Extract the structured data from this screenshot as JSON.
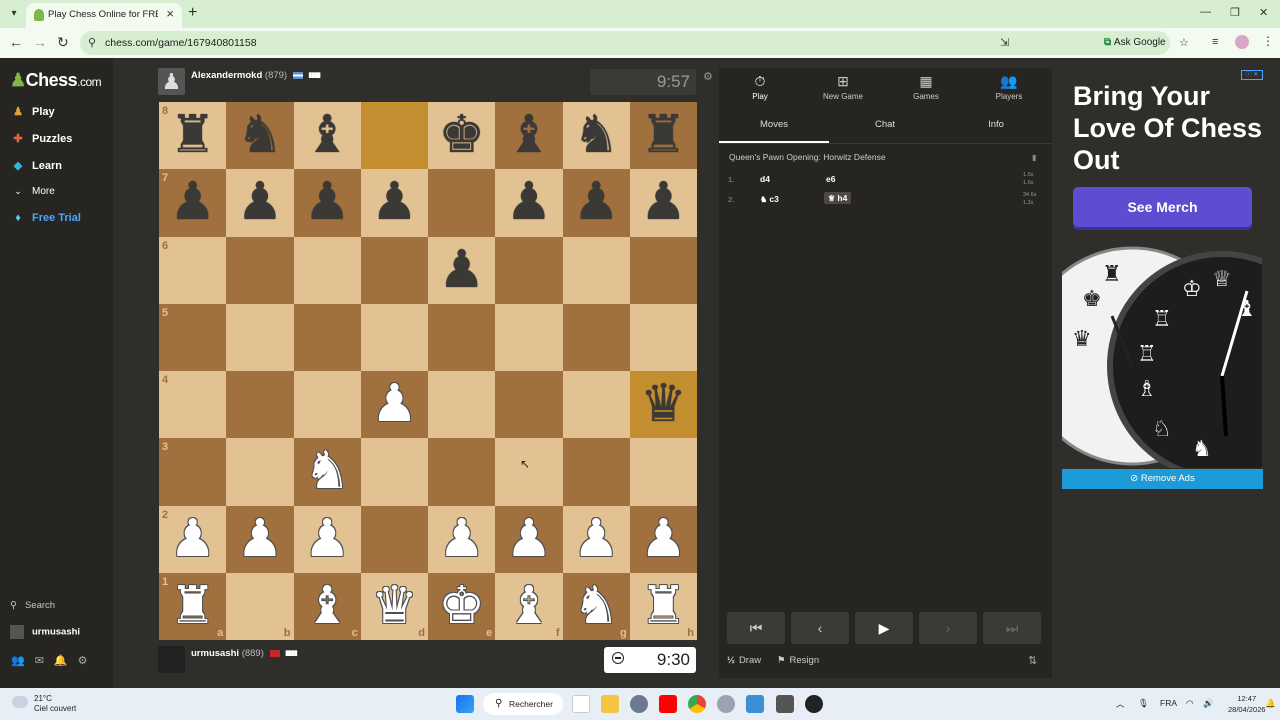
{
  "browser": {
    "tab_title": "Play Chess Online for FREE - 2 P",
    "url": "chess.com/game/167940801158",
    "ask_google": "Ask Google"
  },
  "sidebar": {
    "logo_main": "Chess",
    "logo_suffix": ".com",
    "items": [
      {
        "label": "Play",
        "icon": "play-pawn-icon"
      },
      {
        "label": "Puzzles",
        "icon": "puzzle-icon"
      },
      {
        "label": "Learn",
        "icon": "learn-cap-icon"
      },
      {
        "label": "More",
        "icon": "chevron-down-icon"
      },
      {
        "label": "Free Trial",
        "icon": "diamond-icon"
      }
    ],
    "search": "Search",
    "username": "urmusashi"
  },
  "top_player": {
    "name": "Alexandermokd",
    "rating": "(879)",
    "clock": "9:57"
  },
  "bottom_player": {
    "name": "urmusashi",
    "rating": "(889)",
    "clock": "9:30"
  },
  "board": {
    "ranks": [
      "8",
      "7",
      "6",
      "5",
      "4",
      "3",
      "2",
      "1"
    ],
    "files": [
      "a",
      "b",
      "c",
      "d",
      "e",
      "f",
      "g",
      "h"
    ],
    "highlight": [
      "d8",
      "h4"
    ],
    "pieces": {
      "a8": "bR",
      "b8": "bN",
      "c8": "bB",
      "e8": "bK",
      "f8": "bB",
      "g8": "bN",
      "h8": "bR",
      "a7": "bP",
      "b7": "bP",
      "c7": "bP",
      "d7": "bP",
      "f7": "bP",
      "g7": "bP",
      "h7": "bP",
      "e6": "bP",
      "h4": "bQ",
      "d4": "wP",
      "c3": "wN",
      "a2": "wP",
      "b2": "wP",
      "c2": "wP",
      "e2": "wP",
      "f2": "wP",
      "g2": "wP",
      "h2": "wP",
      "a1": "wR",
      "c1": "wB",
      "d1": "wQ",
      "e1": "wK",
      "f1": "wB",
      "g1": "wN",
      "h1": "wR"
    }
  },
  "panel": {
    "tabs": [
      {
        "label": "Play",
        "icon": "stopwatch-icon"
      },
      {
        "label": "New Game",
        "icon": "plus-square-icon"
      },
      {
        "label": "Games",
        "icon": "board-icon"
      },
      {
        "label": "Players",
        "icon": "players-icon"
      }
    ],
    "subtabs": [
      "Moves",
      "Chat",
      "Info"
    ],
    "opening": "Queen's Pawn Opening: Horwitz Defense",
    "moves": [
      {
        "num": "1.",
        "white": "d4",
        "black": "e6",
        "wtime": "1.5s",
        "btime": "1.6s"
      },
      {
        "num": "2.",
        "white": "c3",
        "black": "h4",
        "wtime": "34.6s",
        "btime": "1.2s"
      }
    ],
    "draw": "Draw",
    "resign": "Resign",
    "draw_prefix": "½"
  },
  "ad": {
    "title": "Bring Your Love Of Chess Out",
    "button": "See Merch",
    "remove": "Remove Ads"
  },
  "taskbar": {
    "temp": "21°C",
    "weather": "Ciel couvert",
    "search": "Rechercher",
    "lang": "FRA",
    "time": "12:47",
    "date": "28/04/2026"
  }
}
